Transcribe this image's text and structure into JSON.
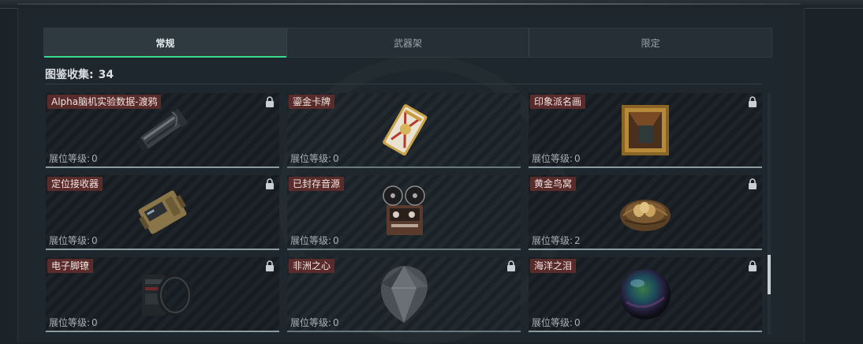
{
  "tabs": [
    {
      "label": "常规",
      "active": true
    },
    {
      "label": "武器架",
      "active": false
    },
    {
      "label": "限定",
      "active": false
    }
  ],
  "collection": {
    "label": "图鉴收集:",
    "count": "34"
  },
  "level_label": "展位等级:",
  "items": [
    {
      "name": "Alpha脑机实验数据-渡鸦",
      "level": "0",
      "locked": true,
      "icon": "gun-barrel-device"
    },
    {
      "name": "鎏金卡牌",
      "level": "0",
      "locked": false,
      "icon": "gilded-card"
    },
    {
      "name": "印象派名画",
      "level": "0",
      "locked": true,
      "icon": "framed-painting"
    },
    {
      "name": "定位接收器",
      "level": "0",
      "locked": true,
      "icon": "receiver-device"
    },
    {
      "name": "已封存音源",
      "level": "0",
      "locked": false,
      "icon": "reel-tape-recorder"
    },
    {
      "name": "黄金鸟窝",
      "level": "2",
      "locked": true,
      "icon": "bird-nest-golden-eggs"
    },
    {
      "name": "电子脚镣",
      "level": "0",
      "locked": true,
      "icon": "electronic-ankle-monitor"
    },
    {
      "name": "非洲之心",
      "level": "0",
      "locked": true,
      "icon": "dark-diamond"
    },
    {
      "name": "海洋之泪",
      "level": "0",
      "locked": true,
      "icon": "ocean-orb"
    }
  ],
  "colors": {
    "accent": "#3bd98d",
    "title_bg": "#5a2b2b",
    "panel": "#1e272d"
  }
}
